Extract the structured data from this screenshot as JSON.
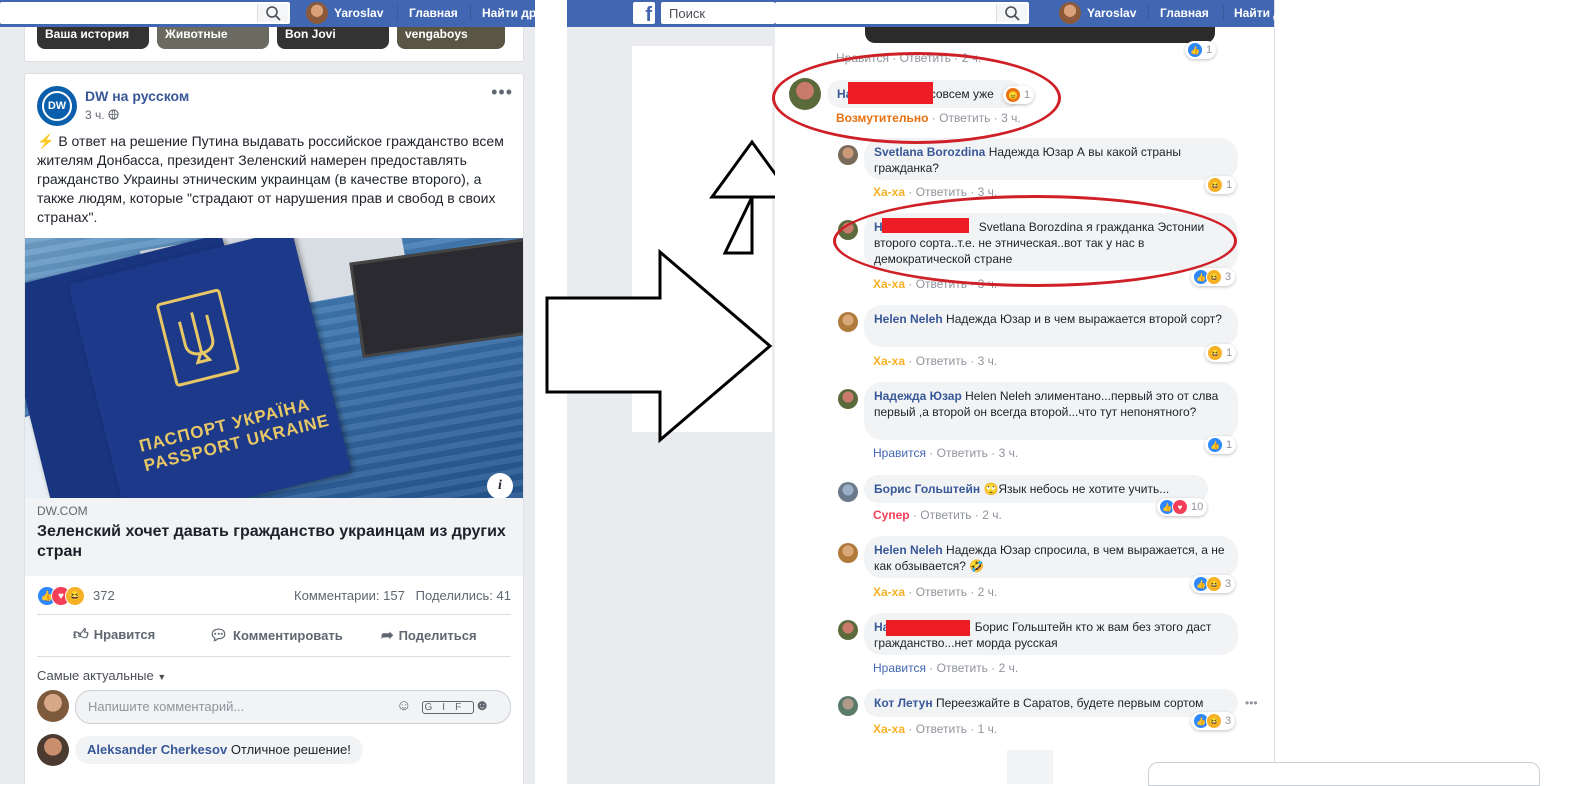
{
  "left": {
    "top_bar": {
      "user_name": "Yaroslav",
      "nav_home": "Главная",
      "nav_find": "Найти дру"
    },
    "stories": [
      "Ваша история",
      "Животные",
      "Bon Jovi",
      "vengaboys"
    ],
    "post": {
      "page_name": "DW на русском",
      "logo_text": "DW",
      "time": "3 ч.",
      "more": "•••",
      "text": "В ответ на решение Путина выдавать российское гражданство всем жителям Донбасса, президент Зеленский намерен предоставлять гражданство Украины этническим украинцам (в качестве второго), а также людям, которые \"страдают от нарушения прав и свобод в своих странах\".",
      "image_caption_line1": "ПАСПОРТ УКРАЇНА",
      "image_caption_line2": "PASSPORT UKRAINE",
      "link_domain": "DW.COM",
      "link_title": "Зеленский хочет давать гражданство украинцам из других стран",
      "reaction_count": "372",
      "comments_count": "Комментарии: 157",
      "shares_count": "Поделились: 41",
      "btn_like": "Нравится",
      "btn_comment": "Комментировать",
      "btn_share": "Поделиться",
      "sort_label": "Самые актуальные",
      "comment_placeholder": "Напишите комментарий...",
      "first_comment_author": "Aleksander Cherkesov",
      "first_comment_text": "Отличное решение!"
    }
  },
  "right": {
    "top_bar": {
      "search_placeholder": "Поиск",
      "user_name": "Yaroslav",
      "nav_home": "Главная",
      "nav_find": "Найти д"
    },
    "prev_meta": {
      "text": "Нравится · Ответить · 2 ч.",
      "count": "1"
    },
    "comments": [
      {
        "author_visible": "На",
        "text": "совсем уже",
        "reaction": "Возмутительно",
        "reply": "Ответить",
        "time": "3 ч.",
        "count": "1"
      },
      {
        "author": "Svetlana Borozdina",
        "text": "Надежда Юзар А вы какой страны гражданка?",
        "reaction": "Ха-ха",
        "reply": "Ответить",
        "time": "3 ч.",
        "count": "1"
      },
      {
        "author_visible": "На",
        "text": "Svetlana Borozdina я гражданка Эстонии второго сорта..т.е. не этническая..вот так у нас в демократической стране",
        "reaction": "Ха-ха",
        "reply": "Ответить",
        "time": "3 ч.",
        "count": "3"
      },
      {
        "author": "Helen Neleh",
        "text": "Надежда Юзар и в чем выражается второй сорт?",
        "reaction": "Ха-ха",
        "reply": "Ответить",
        "time": "3 ч.",
        "count": "1"
      },
      {
        "author": "Надежда Юзар",
        "text": "Helen Neleh элиментано...первый это от слва первый ,а второй он всегда второй...что тут непонятного?",
        "reaction": "Нравится",
        "reply": "Ответить",
        "time": "3 ч.",
        "count": "1"
      },
      {
        "author": "Борис Гольштейн",
        "text": "Язык небось не хотите учить...",
        "reaction": "Супер",
        "reply": "Ответить",
        "time": "2 ч.",
        "count": "10"
      },
      {
        "author": "Helen Neleh",
        "text": "Надежда Юзар спросила, в чем выражается, а не как обзывается?",
        "reaction": "Ха-ха",
        "reply": "Ответить",
        "time": "2 ч.",
        "count": "3"
      },
      {
        "author_visible": "На",
        "text": "Борис Гольштейн кто ж вам без этого даст гражданство...нет морда русская",
        "reaction": "Нравится",
        "reply": "Ответить",
        "time": "2 ч.",
        "count": ""
      },
      {
        "author": "Кот Летун",
        "text": "Переезжайте в Саратов, будете первым сортом",
        "reaction": "Ха-ха",
        "reply": "Ответить",
        "time": "1 ч.",
        "count": "3"
      }
    ]
  },
  "colors": {
    "fb_blue": "#4267b2",
    "link_blue": "#385898",
    "highlight_red": "#cf2027",
    "redaction_red": "#ee1c24",
    "haha_yellow": "#f7b125",
    "angry_orange": "#e9710f"
  },
  "icons": [
    "search-icon",
    "facebook-logo-icon",
    "globe-icon",
    "info-icon",
    "like-icon",
    "comment-icon",
    "share-icon",
    "emoji-icon",
    "gif-icon",
    "sticker-icon",
    "arrow-up-icon",
    "arrow-right-icon"
  ]
}
